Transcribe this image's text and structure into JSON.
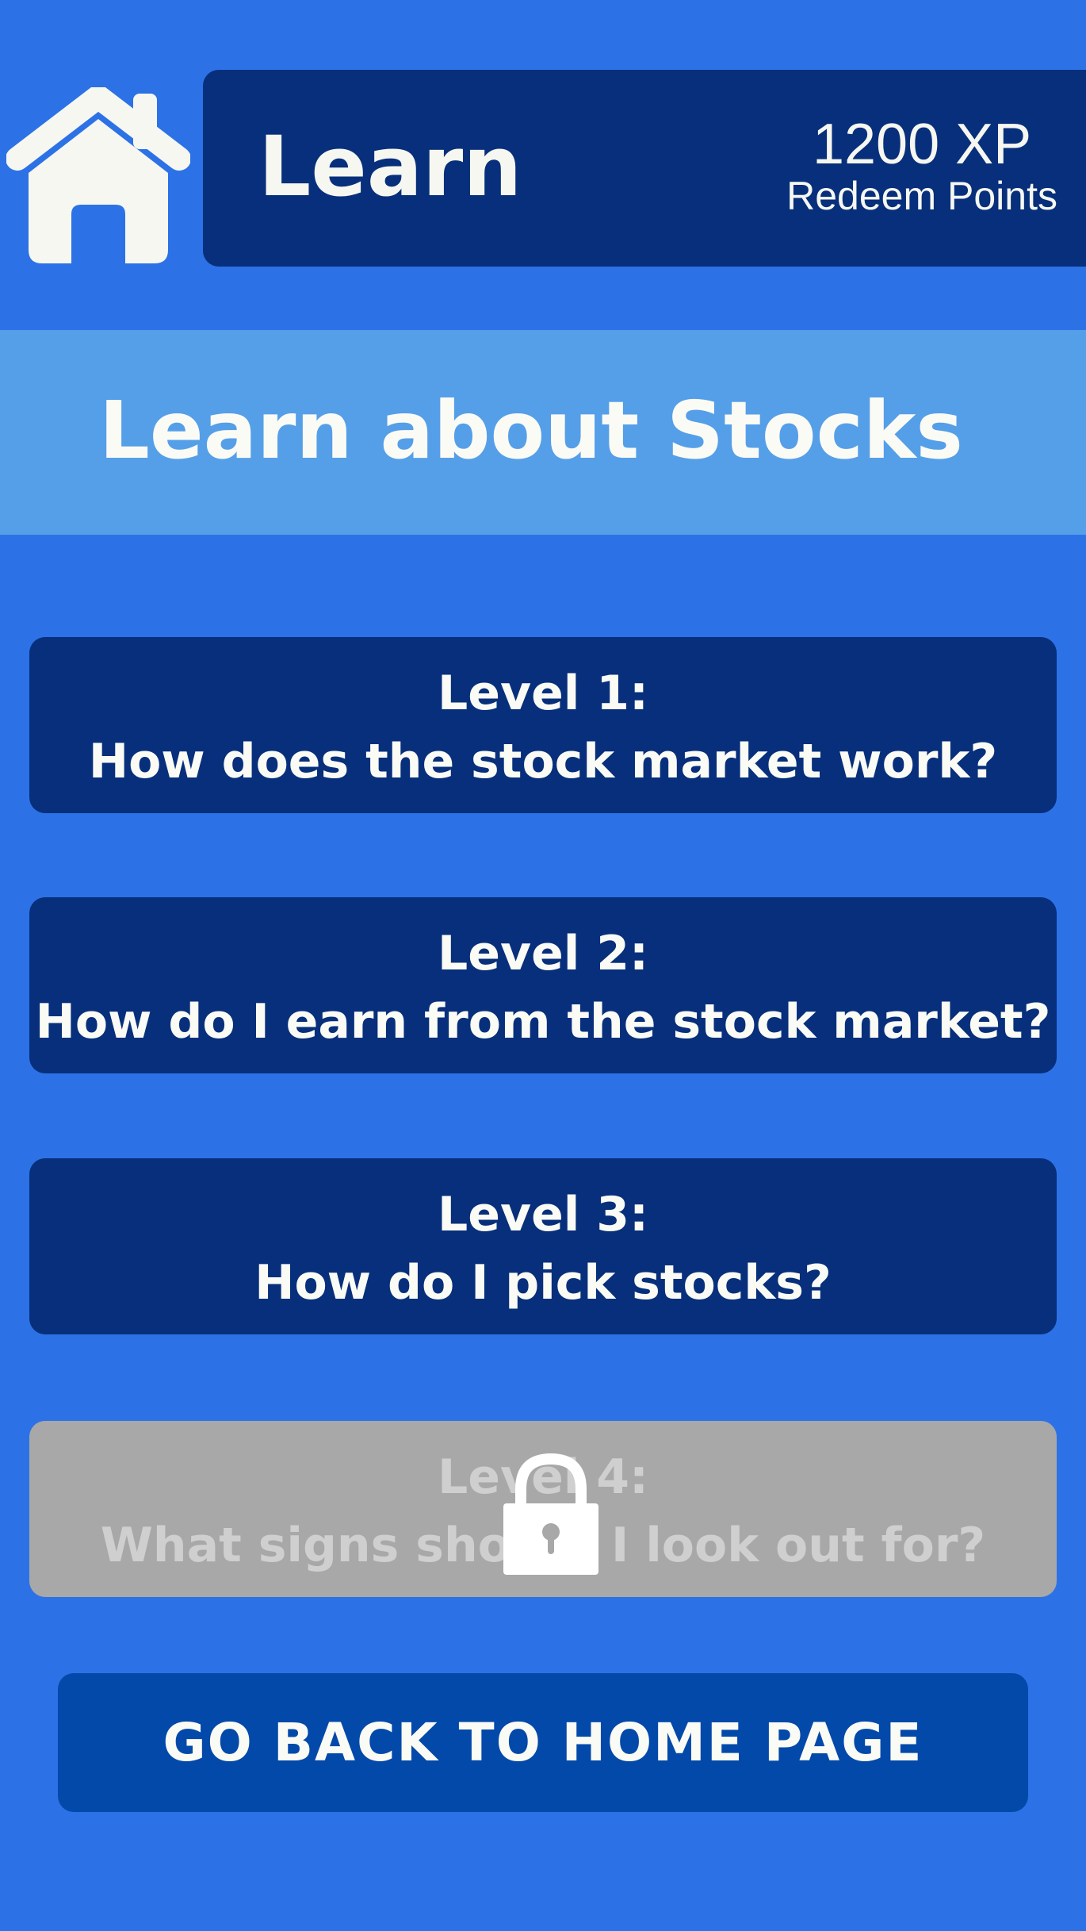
{
  "header": {
    "title": "Learn",
    "xp_value": "1200 XP",
    "redeem_label": "Redeem Points",
    "home_icon": "home-icon"
  },
  "topic": {
    "title": "Learn about Stocks"
  },
  "levels": [
    {
      "label": "Level 1:",
      "question": "How does the stock market work?",
      "locked": false
    },
    {
      "label": "Level 2:",
      "question": "How do I earn from the stock market?",
      "locked": false
    },
    {
      "label": "Level 3:",
      "question": "How do I pick stocks?",
      "locked": false
    },
    {
      "label": "Level 4:",
      "question": "What signs should I look out for?",
      "locked": true,
      "lock_icon": "lock-icon"
    }
  ],
  "footer": {
    "back_label": "GO BACK TO HOME PAGE"
  },
  "colors": {
    "background": "#2c72e6",
    "header_bar": "#072f7b",
    "topic_banner": "#559fe8",
    "level_button": "#072f7b",
    "locked_button": "#a8a8a8",
    "back_button": "#0349a9",
    "text_light": "#fbfbf6"
  }
}
